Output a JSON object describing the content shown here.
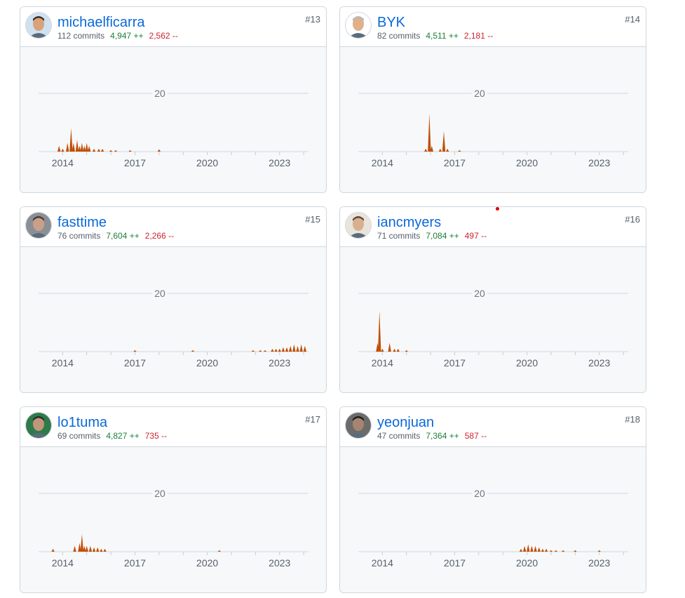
{
  "colors": {
    "accent": "#0969da",
    "additions": "#1a7f37",
    "deletions": "#cf222e",
    "area": "#c24e00"
  },
  "y_gridline_label": "20",
  "x_tick_labels": [
    "2014",
    "2017",
    "2020",
    "2023"
  ],
  "contributors": [
    {
      "username": "michaelficarra",
      "commits": "112 commits",
      "additions": "4,947 ++",
      "deletions": "2,562 --",
      "rank": "#13",
      "avatar_icon": "avatar-photo-icon",
      "chart_data": {
        "type": "area",
        "x_unit": "year",
        "xlim": [
          2013.0,
          2024.2
        ],
        "ylim": [
          0,
          24
        ],
        "ytick": 20,
        "points": [
          [
            2013.85,
            2
          ],
          [
            2014.0,
            1
          ],
          [
            2014.2,
            3
          ],
          [
            2014.35,
            8
          ],
          [
            2014.45,
            3
          ],
          [
            2014.6,
            4
          ],
          [
            2014.7,
            2
          ],
          [
            2014.8,
            3
          ],
          [
            2014.9,
            2
          ],
          [
            2015.0,
            3
          ],
          [
            2015.1,
            2
          ],
          [
            2015.3,
            1
          ],
          [
            2015.5,
            1
          ],
          [
            2015.65,
            1
          ],
          [
            2016.0,
            0.5
          ],
          [
            2016.2,
            0.5
          ],
          [
            2016.8,
            0.5
          ],
          [
            2018.0,
            0.8
          ]
        ]
      }
    },
    {
      "username": "BYK",
      "commits": "82 commits",
      "additions": "4,511 ++",
      "deletions": "2,181 --",
      "rank": "#14",
      "avatar_icon": "avatar-photo-icon",
      "chart_data": {
        "type": "area",
        "x_unit": "year",
        "xlim": [
          2013.0,
          2024.2
        ],
        "ylim": [
          0,
          24
        ],
        "ytick": 20,
        "points": [
          [
            2015.8,
            1
          ],
          [
            2015.95,
            13
          ],
          [
            2016.05,
            2
          ],
          [
            2016.4,
            1
          ],
          [
            2016.55,
            7
          ],
          [
            2016.7,
            1
          ],
          [
            2017.2,
            0.5
          ]
        ]
      }
    },
    {
      "username": "fasttime",
      "commits": "76 commits",
      "additions": "7,604 ++",
      "deletions": "2,266 --",
      "rank": "#15",
      "avatar_icon": "avatar-photo-icon",
      "chart_data": {
        "type": "area",
        "x_unit": "year",
        "xlim": [
          2013.0,
          2024.2
        ],
        "ylim": [
          0,
          24
        ],
        "ytick": 20,
        "points": [
          [
            2017.0,
            0.5
          ],
          [
            2019.4,
            0.5
          ],
          [
            2021.9,
            0.5
          ],
          [
            2022.2,
            0.5
          ],
          [
            2022.4,
            0.5
          ],
          [
            2022.7,
            1
          ],
          [
            2022.85,
            1
          ],
          [
            2023.0,
            1
          ],
          [
            2023.15,
            1.5
          ],
          [
            2023.3,
            1.5
          ],
          [
            2023.45,
            2
          ],
          [
            2023.6,
            2.5
          ],
          [
            2023.75,
            2
          ],
          [
            2023.9,
            2.5
          ],
          [
            2024.05,
            2
          ]
        ]
      }
    },
    {
      "username": "iancmyers",
      "commits": "71 commits",
      "additions": "7,084 ++",
      "deletions": "497 --",
      "rank": "#16",
      "avatar_icon": "avatar-photo-icon",
      "chart_data": {
        "type": "area",
        "x_unit": "year",
        "xlim": [
          2013.0,
          2024.2
        ],
        "ylim": [
          0,
          24
        ],
        "ytick": 20,
        "points": [
          [
            2013.8,
            3
          ],
          [
            2013.88,
            14
          ],
          [
            2014.0,
            1
          ],
          [
            2014.3,
            3
          ],
          [
            2014.5,
            1
          ],
          [
            2014.65,
            1
          ],
          [
            2015.0,
            0.5
          ]
        ]
      }
    },
    {
      "username": "lo1tuma",
      "commits": "69 commits",
      "additions": "4,827 ++",
      "deletions": "735 --",
      "rank": "#17",
      "avatar_icon": "avatar-photo-icon",
      "chart_data": {
        "type": "area",
        "x_unit": "year",
        "xlim": [
          2013.0,
          2024.2
        ],
        "ylim": [
          0,
          24
        ],
        "ytick": 20,
        "points": [
          [
            2013.6,
            1
          ],
          [
            2014.5,
            2
          ],
          [
            2014.7,
            3
          ],
          [
            2014.8,
            6
          ],
          [
            2014.9,
            2
          ],
          [
            2015.0,
            2
          ],
          [
            2015.15,
            2
          ],
          [
            2015.3,
            1.5
          ],
          [
            2015.45,
            1.5
          ],
          [
            2015.6,
            1
          ],
          [
            2015.75,
            1
          ],
          [
            2020.5,
            0.5
          ]
        ]
      }
    },
    {
      "username": "yeonjuan",
      "commits": "47 commits",
      "additions": "7,364 ++",
      "deletions": "587 --",
      "rank": "#18",
      "avatar_icon": "avatar-photo-icon",
      "chart_data": {
        "type": "area",
        "x_unit": "year",
        "xlim": [
          2013.0,
          2024.2
        ],
        "ylim": [
          0,
          24
        ],
        "ytick": 20,
        "points": [
          [
            2019.75,
            1
          ],
          [
            2019.9,
            2
          ],
          [
            2020.05,
            2.5
          ],
          [
            2020.2,
            2
          ],
          [
            2020.35,
            2
          ],
          [
            2020.5,
            1.5
          ],
          [
            2020.65,
            1
          ],
          [
            2020.8,
            1
          ],
          [
            2021.0,
            0.5
          ],
          [
            2021.2,
            0.5
          ],
          [
            2021.5,
            0.5
          ],
          [
            2022.0,
            0.5
          ],
          [
            2023.0,
            0.5
          ]
        ]
      }
    }
  ]
}
